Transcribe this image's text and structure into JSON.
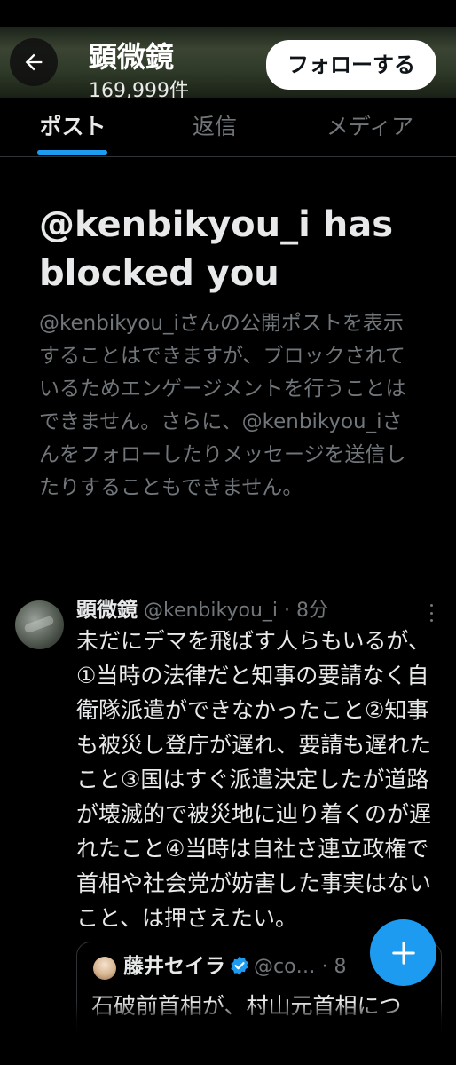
{
  "header": {
    "title": "顕微鏡",
    "post_count": "169,999件",
    "follow_label": "フォローする"
  },
  "tabs": [
    {
      "label": "ポスト",
      "active": true
    },
    {
      "label": "返信",
      "active": false
    },
    {
      "label": "メディア",
      "active": false
    }
  ],
  "blocked": {
    "title": "@kenbikyou_i has blocked you",
    "body": "@kenbikyou_iさんの公開ポストを表示することはできますが、ブロックされているためエンゲージメントを行うことはできません。さらに、@kenbikyou_iさんをフォローしたりメッセージを送信したりすることもできません。"
  },
  "tweet": {
    "name": "顕微鏡",
    "handle": "@kenbikyou_i",
    "separator": "·",
    "time": "8分",
    "text": "未だにデマを飛ばす人らもいるが、①当時の法律だと知事の要請なく自衛隊派遣ができなかったこと②知事も被災し登庁が遅れ、要請も遅れたこと③国はすぐ派遣決定したが道路が壊滅的で被災地に辿り着くのが遅れたこと④当時は自社さ連立政権で首相や社会党が妨害した事実はないこと、は押さえたい。",
    "quote": {
      "name": "藤井セイラ",
      "handle": "@co…",
      "time": "· 8",
      "text": "石破前首相が、村山元首相につ"
    }
  },
  "icons": {
    "back": "arrow-left-icon",
    "more": "more-vertical-icon",
    "verified": "verified-badge-icon",
    "compose": "plus-icon"
  },
  "colors": {
    "accent": "#1d9bf0",
    "background": "#000000",
    "text_primary": "#e7e9ea",
    "text_secondary": "#71767b"
  }
}
